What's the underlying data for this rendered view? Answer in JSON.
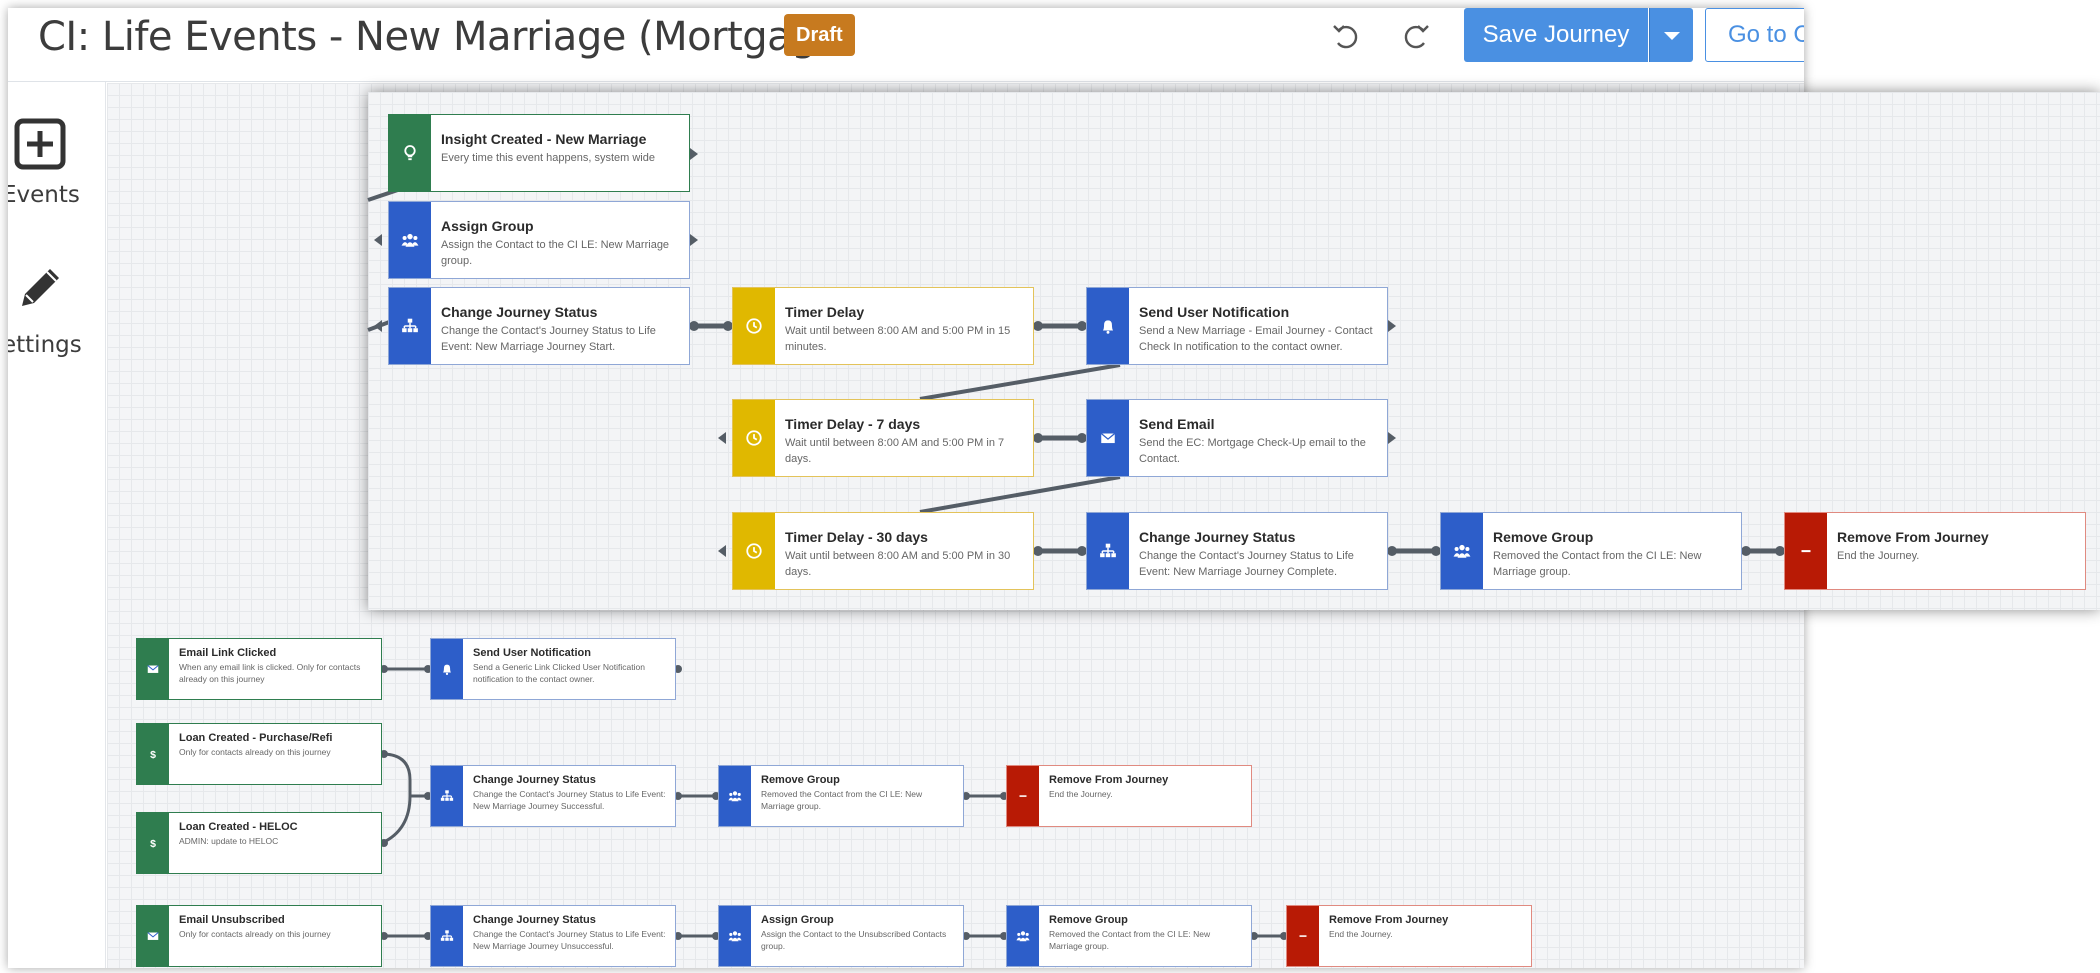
{
  "header": {
    "title": "CI: Life Events - New Marriage (Mortgage)",
    "status_badge": "Draft",
    "save_button": "Save Journey",
    "goto_button": "Go to C"
  },
  "left_rail": {
    "events_label": "Events",
    "settings_label": "ettings"
  },
  "front_panel": {
    "nodes": [
      {
        "title": "Insight Created - New Marriage",
        "desc": "Every time this event happens, system wide",
        "color": "green",
        "icon": "lightbulb-icon"
      },
      {
        "title": "Assign Group",
        "desc": "Assign the Contact to the CI LE: New Marriage group.",
        "color": "blue",
        "icon": "group-icon"
      },
      {
        "title": "Change Journey Status",
        "desc": "Change the Contact's Journey Status to Life Event: New Marriage Journey Start.",
        "color": "blue",
        "icon": "org-chart-icon"
      },
      {
        "title": "Timer Delay",
        "desc": "Wait until between 8:00 AM and 5:00 PM in 15 minutes.",
        "color": "yellow",
        "icon": "clock-icon"
      },
      {
        "title": "Send User Notification",
        "desc": "Send a New Marriage - Email Journey - Contact Check In notification to the contact owner.",
        "color": "blue",
        "icon": "bell-icon"
      },
      {
        "title": "Timer Delay - 7 days",
        "desc": "Wait until between 8:00 AM and 5:00 PM in 7 days.",
        "color": "yellow",
        "icon": "clock-icon"
      },
      {
        "title": "Send Email",
        "desc": "Send the EC: Mortgage Check-Up email to the Contact.",
        "color": "blue",
        "icon": "envelope-icon"
      },
      {
        "title": "Timer Delay - 30 days",
        "desc": "Wait until between 8:00 AM and 5:00 PM in 30 days.",
        "color": "yellow",
        "icon": "clock-icon"
      },
      {
        "title": "Change Journey Status",
        "desc": "Change the Contact's Journey Status to Life Event: New Marriage Journey Complete.",
        "color": "blue",
        "icon": "org-chart-icon"
      },
      {
        "title": "Remove Group",
        "desc": "Removed the Contact from the CI LE: New Marriage group.",
        "color": "blue",
        "icon": "group-icon"
      },
      {
        "title": "Remove From Journey",
        "desc": "End the Journey.",
        "color": "red",
        "icon": "minus-icon"
      }
    ]
  },
  "back_canvas": {
    "nodes": [
      {
        "title": "Email Link Clicked",
        "desc": "When any email link is clicked. Only for contacts already on this journey",
        "color": "green",
        "icon": "envelope-icon"
      },
      {
        "title": "Send User Notification",
        "desc": "Send a Generic Link Clicked User Notification notification to the contact owner.",
        "color": "blue",
        "icon": "bell-icon"
      },
      {
        "title": "Loan Created - Purchase/Refi",
        "desc": "Only for contacts already on this journey",
        "color": "green",
        "icon": "dollar-icon"
      },
      {
        "title": "Loan Created - HELOC",
        "desc": "ADMIN: update to HELOC",
        "color": "green",
        "icon": "dollar-icon"
      },
      {
        "title": "Change Journey Status",
        "desc": "Change the Contact's Journey Status to Life Event: New Marriage Journey Successful.",
        "color": "blue",
        "icon": "org-chart-icon"
      },
      {
        "title": "Remove Group",
        "desc": "Removed the Contact from the CI LE: New Marriage group.",
        "color": "blue",
        "icon": "group-icon"
      },
      {
        "title": "Remove From Journey",
        "desc": "End the Journey.",
        "color": "red",
        "icon": "minus-icon"
      },
      {
        "title": "Email Unsubscribed",
        "desc": "Only for contacts already on this journey",
        "color": "green",
        "icon": "envelope-icon"
      },
      {
        "title": "Change Journey Status",
        "desc": "Change the Contact's Journey Status to Life Event: New Marriage Journey Unsuccessful.",
        "color": "blue",
        "icon": "org-chart-icon"
      },
      {
        "title": "Assign Group",
        "desc": "Assign the Contact to the Unsubscribed Contacts group.",
        "color": "blue",
        "icon": "group-icon"
      },
      {
        "title": "Remove Group",
        "desc": "Removed the Contact from the CI LE: New Marriage group.",
        "color": "blue",
        "icon": "group-icon"
      },
      {
        "title": "Remove From Journey",
        "desc": "End the Journey.",
        "color": "red",
        "icon": "minus-icon"
      }
    ]
  },
  "colors": {
    "green": "#2f7d4f",
    "blue": "#2d5ec9",
    "yellow": "#e0b800",
    "red": "#b81a05",
    "primary_button": "#4a90e2",
    "draft_badge": "#c77a1f"
  }
}
